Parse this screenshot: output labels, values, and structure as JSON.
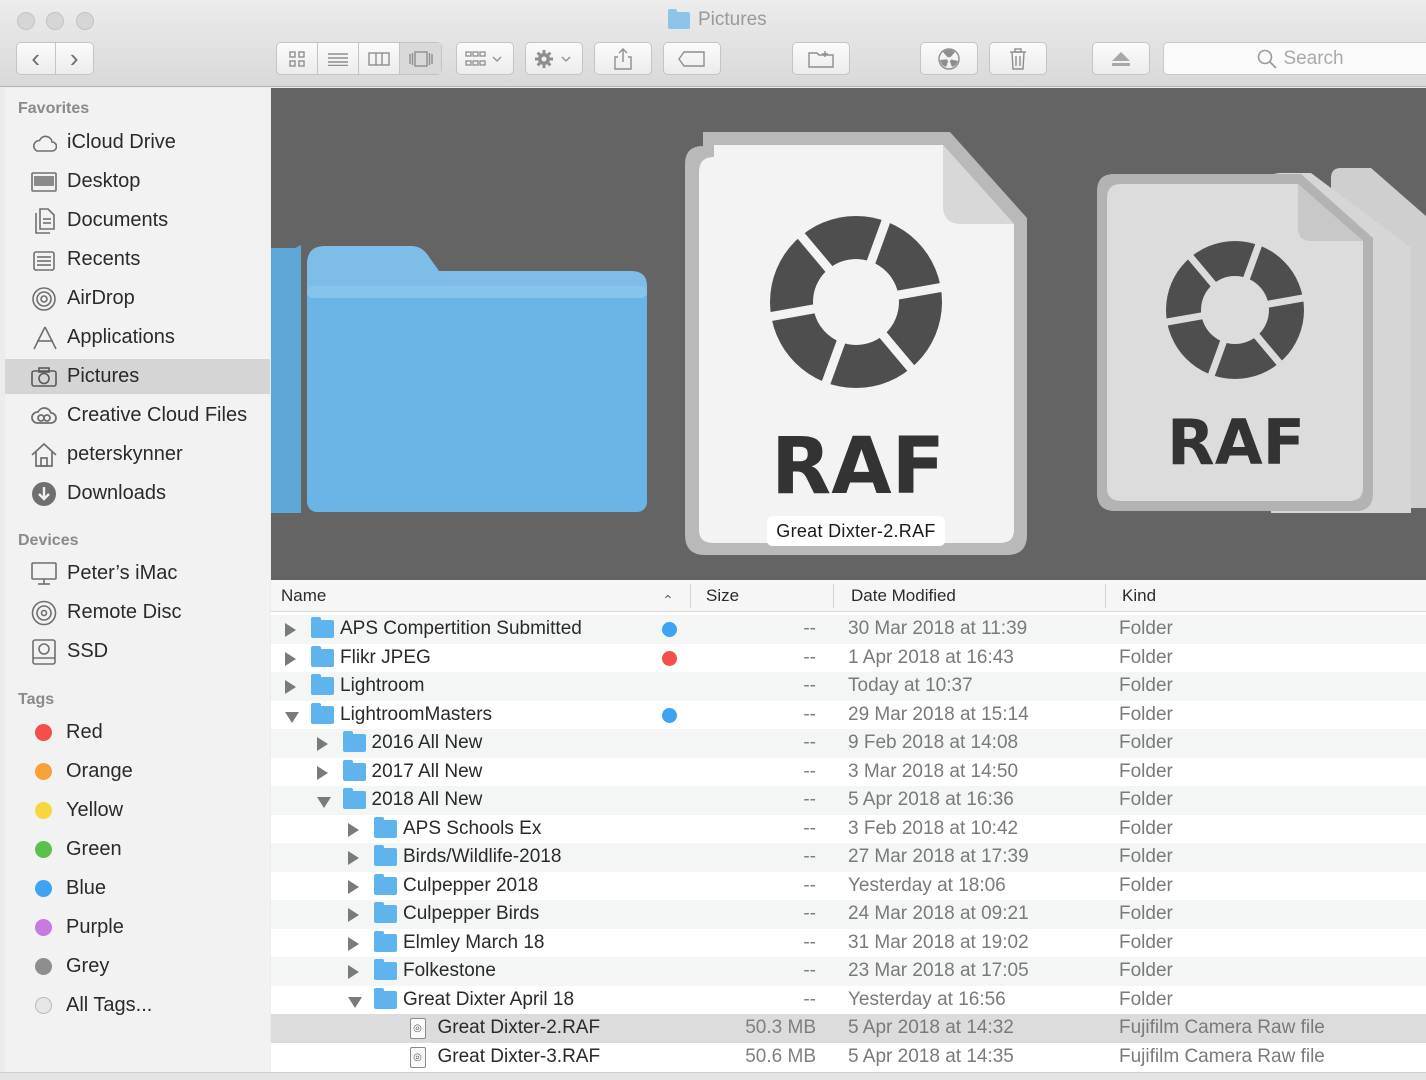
{
  "window": {
    "title": "Pictures"
  },
  "toolbar": {
    "back": "‹",
    "forward": "›",
    "search_placeholder": "Search"
  },
  "sidebar": {
    "favorites_header": "Favorites",
    "favorites": [
      {
        "label": "iCloud Drive",
        "icon": "cloud-icon"
      },
      {
        "label": "Desktop",
        "icon": "desktop-icon"
      },
      {
        "label": "Documents",
        "icon": "documents-icon"
      },
      {
        "label": "Recents",
        "icon": "recents-icon"
      },
      {
        "label": "AirDrop",
        "icon": "airdrop-icon"
      },
      {
        "label": "Applications",
        "icon": "applications-icon"
      },
      {
        "label": "Pictures",
        "icon": "camera-icon",
        "selected": true
      },
      {
        "label": "Creative Cloud Files",
        "icon": "creative-cloud-icon"
      },
      {
        "label": "peterskynner",
        "icon": "home-icon"
      },
      {
        "label": "Downloads",
        "icon": "download-icon"
      }
    ],
    "devices_header": "Devices",
    "devices": [
      {
        "label": "Peter’s iMac",
        "icon": "imac-icon"
      },
      {
        "label": "Remote Disc",
        "icon": "disc-icon"
      },
      {
        "label": "SSD",
        "icon": "drive-icon"
      }
    ],
    "tags_header": "Tags",
    "tags": [
      {
        "label": "Red",
        "color": "#f4504a"
      },
      {
        "label": "Orange",
        "color": "#f7a13b"
      },
      {
        "label": "Yellow",
        "color": "#f8d63e"
      },
      {
        "label": "Green",
        "color": "#5ac14f"
      },
      {
        "label": "Blue",
        "color": "#3ea3f2"
      },
      {
        "label": "Purple",
        "color": "#c77ae0"
      },
      {
        "label": "Grey",
        "color": "#8e8e8e"
      },
      {
        "label": "All Tags...",
        "color": "#e6e6e6"
      }
    ]
  },
  "coverflow": {
    "caption": "Great Dixter-2.RAF",
    "file_label": "RAF",
    "side_label": "RAF"
  },
  "list": {
    "columns": {
      "name": "Name",
      "size": "Size",
      "date": "Date Modified",
      "kind": "Kind"
    },
    "sort_indicator": "⌃",
    "rows": [
      {
        "name": "APS Compertition Submitted",
        "size": "--",
        "date": "30 Mar 2018 at 11:39",
        "kind": "Folder",
        "level": 0,
        "state": "closed",
        "tag": "#3ea3f2"
      },
      {
        "name": "Flikr JPEG",
        "size": "--",
        "date": "1 Apr 2018 at 16:43",
        "kind": "Folder",
        "level": 0,
        "state": "closed",
        "tag": "#f4504a"
      },
      {
        "name": "Lightroom",
        "size": "--",
        "date": "Today at 10:37",
        "kind": "Folder",
        "level": 0,
        "state": "closed",
        "tag": null
      },
      {
        "name": "LightroomMasters",
        "size": "--",
        "date": "29 Mar 2018 at 15:14",
        "kind": "Folder",
        "level": 0,
        "state": "open",
        "tag": "#3ea3f2"
      },
      {
        "name": "2016 All New",
        "size": "--",
        "date": "9 Feb 2018 at 14:08",
        "kind": "Folder",
        "level": 1,
        "state": "closed",
        "tag": null
      },
      {
        "name": "2017 All New",
        "size": "--",
        "date": "3 Mar 2018 at 14:50",
        "kind": "Folder",
        "level": 1,
        "state": "closed",
        "tag": null
      },
      {
        "name": "2018 All New",
        "size": "--",
        "date": "5 Apr 2018 at 16:36",
        "kind": "Folder",
        "level": 1,
        "state": "open",
        "tag": null
      },
      {
        "name": "APS Schools Ex",
        "size": "--",
        "date": "3 Feb 2018 at 10:42",
        "kind": "Folder",
        "level": 2,
        "state": "closed",
        "tag": null
      },
      {
        "name": "Birds/Wildlife-2018",
        "size": "--",
        "date": "27 Mar 2018 at 17:39",
        "kind": "Folder",
        "level": 2,
        "state": "closed",
        "tag": null
      },
      {
        "name": "Culpepper 2018",
        "size": "--",
        "date": "Yesterday at 18:06",
        "kind": "Folder",
        "level": 2,
        "state": "closed",
        "tag": null
      },
      {
        "name": "Culpepper Birds",
        "size": "--",
        "date": "24 Mar 2018 at 09:21",
        "kind": "Folder",
        "level": 2,
        "state": "closed",
        "tag": null
      },
      {
        "name": "Elmley March 18",
        "size": "--",
        "date": "31 Mar 2018 at 19:02",
        "kind": "Folder",
        "level": 2,
        "state": "closed",
        "tag": null
      },
      {
        "name": "Folkestone",
        "size": "--",
        "date": "23 Mar 2018 at 17:05",
        "kind": "Folder",
        "level": 2,
        "state": "closed",
        "tag": null
      },
      {
        "name": "Great Dixter April 18",
        "size": "--",
        "date": "Yesterday at 16:56",
        "kind": "Folder",
        "level": 2,
        "state": "open",
        "tag": null
      },
      {
        "name": "Great Dixter-2.RAF",
        "size": "50.3 MB",
        "date": "5 Apr 2018 at 14:32",
        "kind": "Fujifilm Camera Raw file",
        "level": 3,
        "state": "file",
        "tag": null,
        "selected": true
      },
      {
        "name": "Great Dixter-3.RAF",
        "size": "50.6 MB",
        "date": "5 Apr 2018 at 14:35",
        "kind": "Fujifilm Camera Raw file",
        "level": 3,
        "state": "file",
        "tag": null
      }
    ]
  }
}
